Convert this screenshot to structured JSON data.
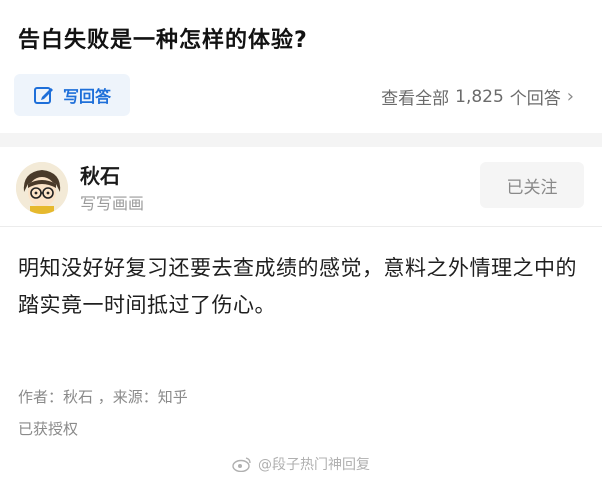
{
  "question": {
    "title": "告白失败是一种怎样的体验?"
  },
  "actions": {
    "write_answer_label": "写回答",
    "view_all_prefix": "查看全部",
    "answer_count": "1,825",
    "view_all_suffix": "个回答",
    "chevron": "›"
  },
  "author": {
    "name": "秋石",
    "bio": "写写画画",
    "follow_label": "已关注"
  },
  "answer": {
    "body": "明知没好好复习还要去查成绩的感觉，意料之外情理之中的踏实竟一时间抵过了伤心。",
    "attribution": "作者：秋石 ，来源：知乎",
    "license": "已获授权"
  },
  "watermark": {
    "text": "@段子热门神回复"
  },
  "colors": {
    "accent": "#1e6fd9",
    "button_bg": "#eef4fb",
    "muted": "#8a8a8a",
    "separator": "#f4f4f4"
  },
  "icons": {
    "write": "pencil-edit-icon",
    "chevron": "chevron-right-icon",
    "avatar": "cartoon-avatar-icon",
    "watermark": "weibo-logo-icon"
  }
}
